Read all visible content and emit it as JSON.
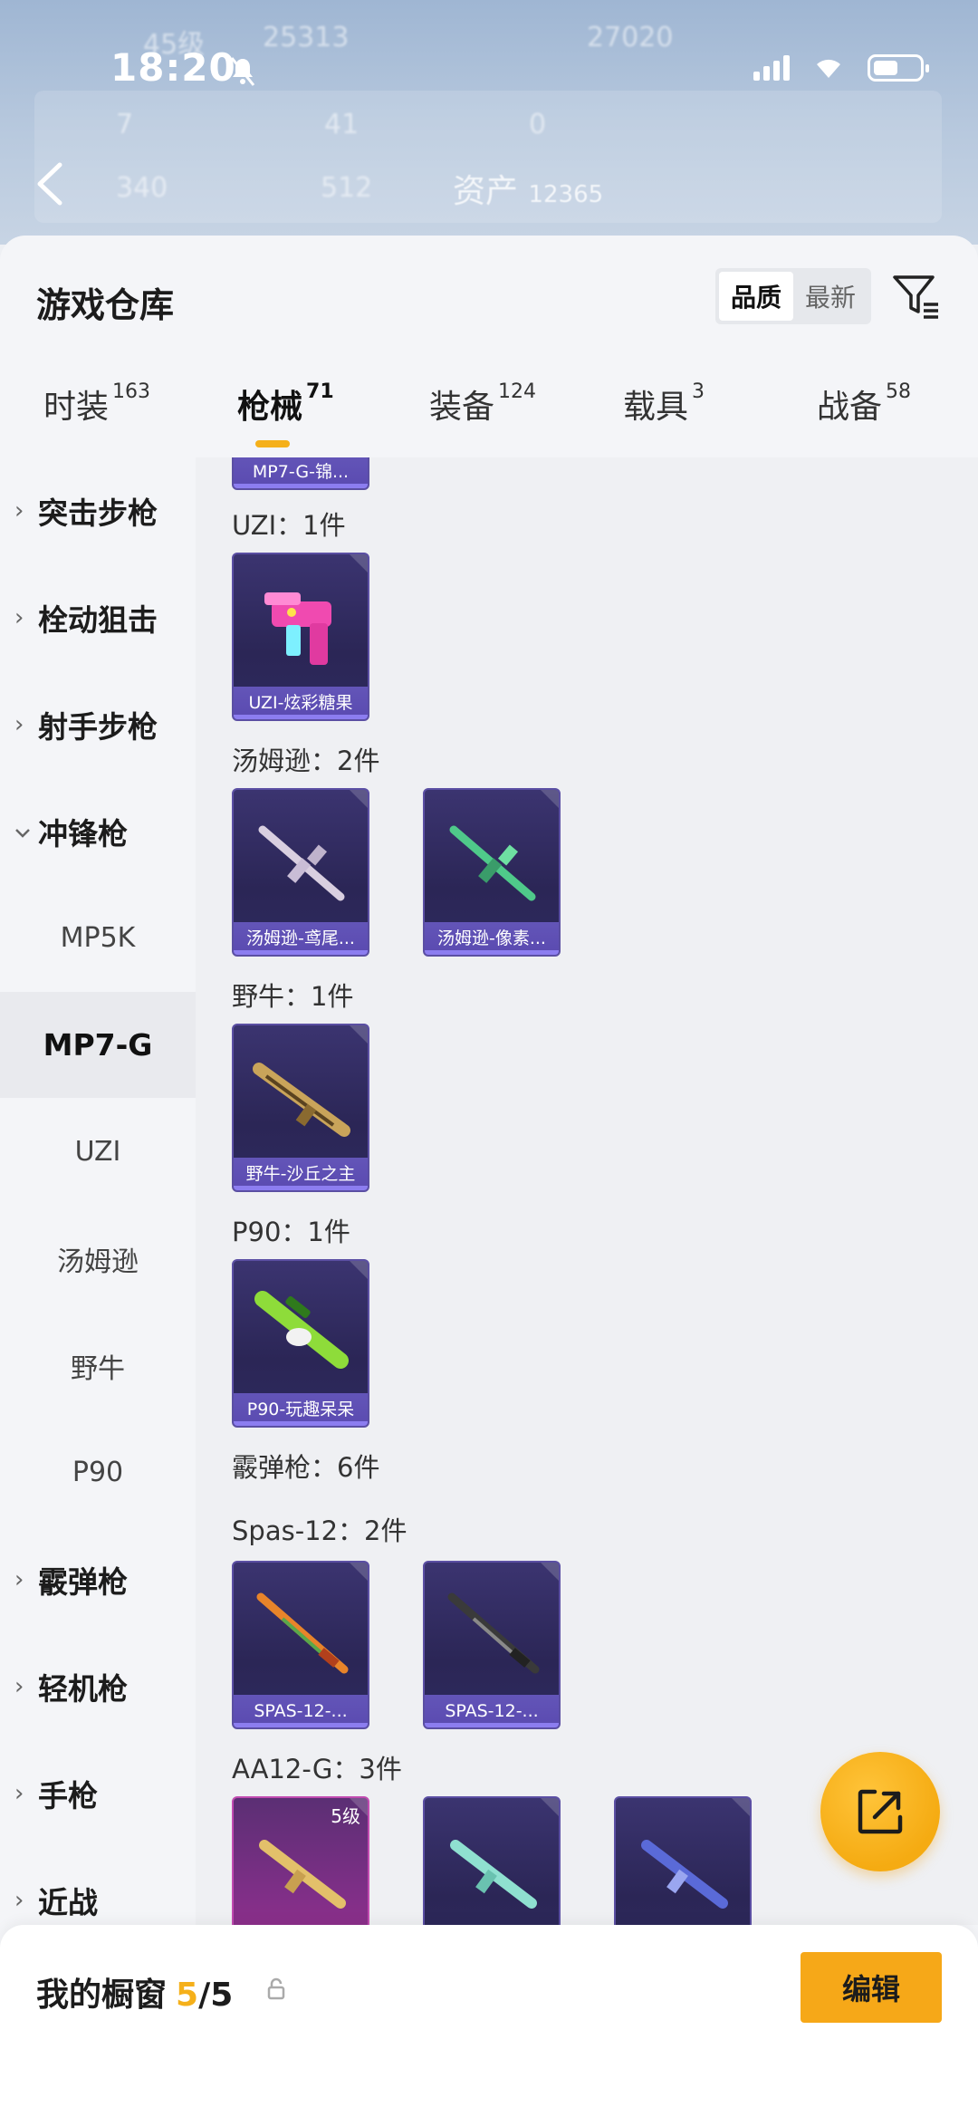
{
  "status_bar": {
    "time": "18:20"
  },
  "header_bg": {
    "assets_label": "资产",
    "assets_value": "12365",
    "stats": [
      "45级",
      "25313",
      "27020",
      "7",
      "41",
      "0",
      "340",
      "512"
    ]
  },
  "sheet": {
    "title": "游戏仓库",
    "sort": {
      "quality": "品质",
      "latest": "最新",
      "active": "品质"
    }
  },
  "tabs": [
    {
      "label": "时装",
      "count": "163"
    },
    {
      "label": "枪械",
      "count": "71",
      "active": true
    },
    {
      "label": "装备",
      "count": "124"
    },
    {
      "label": "载具",
      "count": "3"
    },
    {
      "label": "战备",
      "count": "58"
    }
  ],
  "sidebar": [
    {
      "label": "突击步枪",
      "type": "category",
      "expanded": false
    },
    {
      "label": "栓动狙击",
      "type": "category",
      "expanded": false
    },
    {
      "label": "射手步枪",
      "type": "category",
      "expanded": false
    },
    {
      "label": "冲锋枪",
      "type": "category",
      "expanded": true
    },
    {
      "label": "MP5K",
      "type": "sub"
    },
    {
      "label": "MP7-G",
      "type": "sub",
      "selected": true
    },
    {
      "label": "UZI",
      "type": "sub"
    },
    {
      "label": "汤姆逊",
      "type": "sub"
    },
    {
      "label": "野牛",
      "type": "sub"
    },
    {
      "label": "P90",
      "type": "sub"
    },
    {
      "label": "霰弹枪",
      "type": "category",
      "expanded": false
    },
    {
      "label": "轻机枪",
      "type": "category",
      "expanded": false
    },
    {
      "label": "手枪",
      "type": "category",
      "expanded": false
    },
    {
      "label": "近战",
      "type": "category",
      "expanded": false
    }
  ],
  "content": {
    "partial_card": "MP7-G-锦...",
    "groups": [
      {
        "title": "UZI：1件",
        "items": [
          "UZI-炫彩糖果"
        ]
      },
      {
        "title": "汤姆逊：2件",
        "items": [
          "汤姆逊-鸢尾...",
          "汤姆逊-像素..."
        ]
      },
      {
        "title": "野牛：1件",
        "items": [
          "野牛-沙丘之主"
        ]
      },
      {
        "title": "P90：1件",
        "items": [
          "P90-玩趣呆呆"
        ]
      },
      {
        "title": "霰弹枪：6件",
        "items": []
      },
      {
        "title": "Spas-12：2件",
        "items": [
          "SPAS-12-...",
          "SPAS-12-..."
        ]
      },
      {
        "title": "AA12-G：3件",
        "items": [
          "",
          "",
          ""
        ],
        "badge": "5级"
      }
    ]
  },
  "bottom_bar": {
    "showcase_label": "我的橱窗",
    "showcase_count": "5",
    "showcase_total": "/5",
    "edit_label": "编辑"
  },
  "colors": {
    "accent": "#f5b01a",
    "card_purple": "#2e2a5e",
    "card_caption": "#5a4ab0"
  },
  "icons": [
    "back-arrow-icon",
    "filter-icon",
    "share-icon",
    "lock-icon",
    "chevron-right-icon",
    "chevron-down-icon"
  ]
}
